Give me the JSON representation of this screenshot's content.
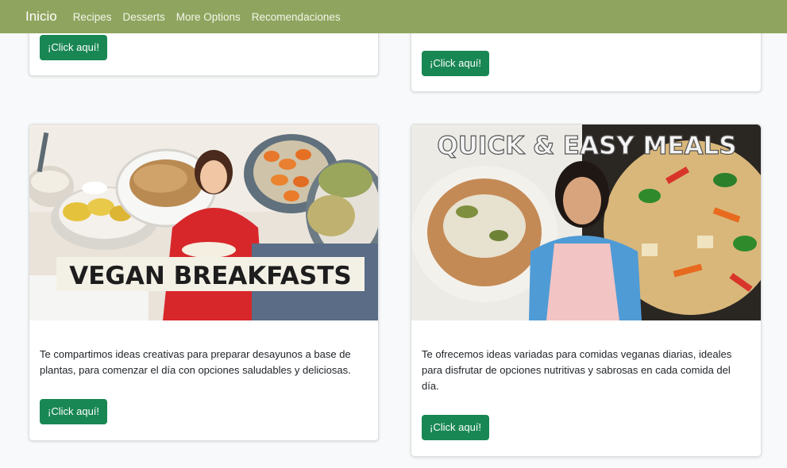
{
  "navbar": {
    "brand": "Inicio",
    "links": [
      "Recipes",
      "Desserts",
      "More Options",
      "Recomendaciones"
    ]
  },
  "cards": [
    {
      "button_label": "¡Click aquí!"
    },
    {
      "button_label": "¡Click aquí!"
    },
    {
      "image_overlay_text": "VEGAN BREAKFASTS",
      "text": "Te compartimos ideas creativas para preparar desayunos a base de plantas, para comenzar el día con opciones saludables y deliciosas.",
      "button_label": "¡Click aquí!"
    },
    {
      "image_overlay_text": "QUICK & EASY MEALS",
      "text": "Te ofrecemos ideas variadas para comidas veganas diarias, ideales para disfrutar de opciones nutritivas y sabrosas en cada comida del día.",
      "button_label": "¡Click aquí!"
    }
  ],
  "colors": {
    "navbar": "#8fa55f",
    "button": "#198754",
    "page_background": "#f8f9fa"
  }
}
